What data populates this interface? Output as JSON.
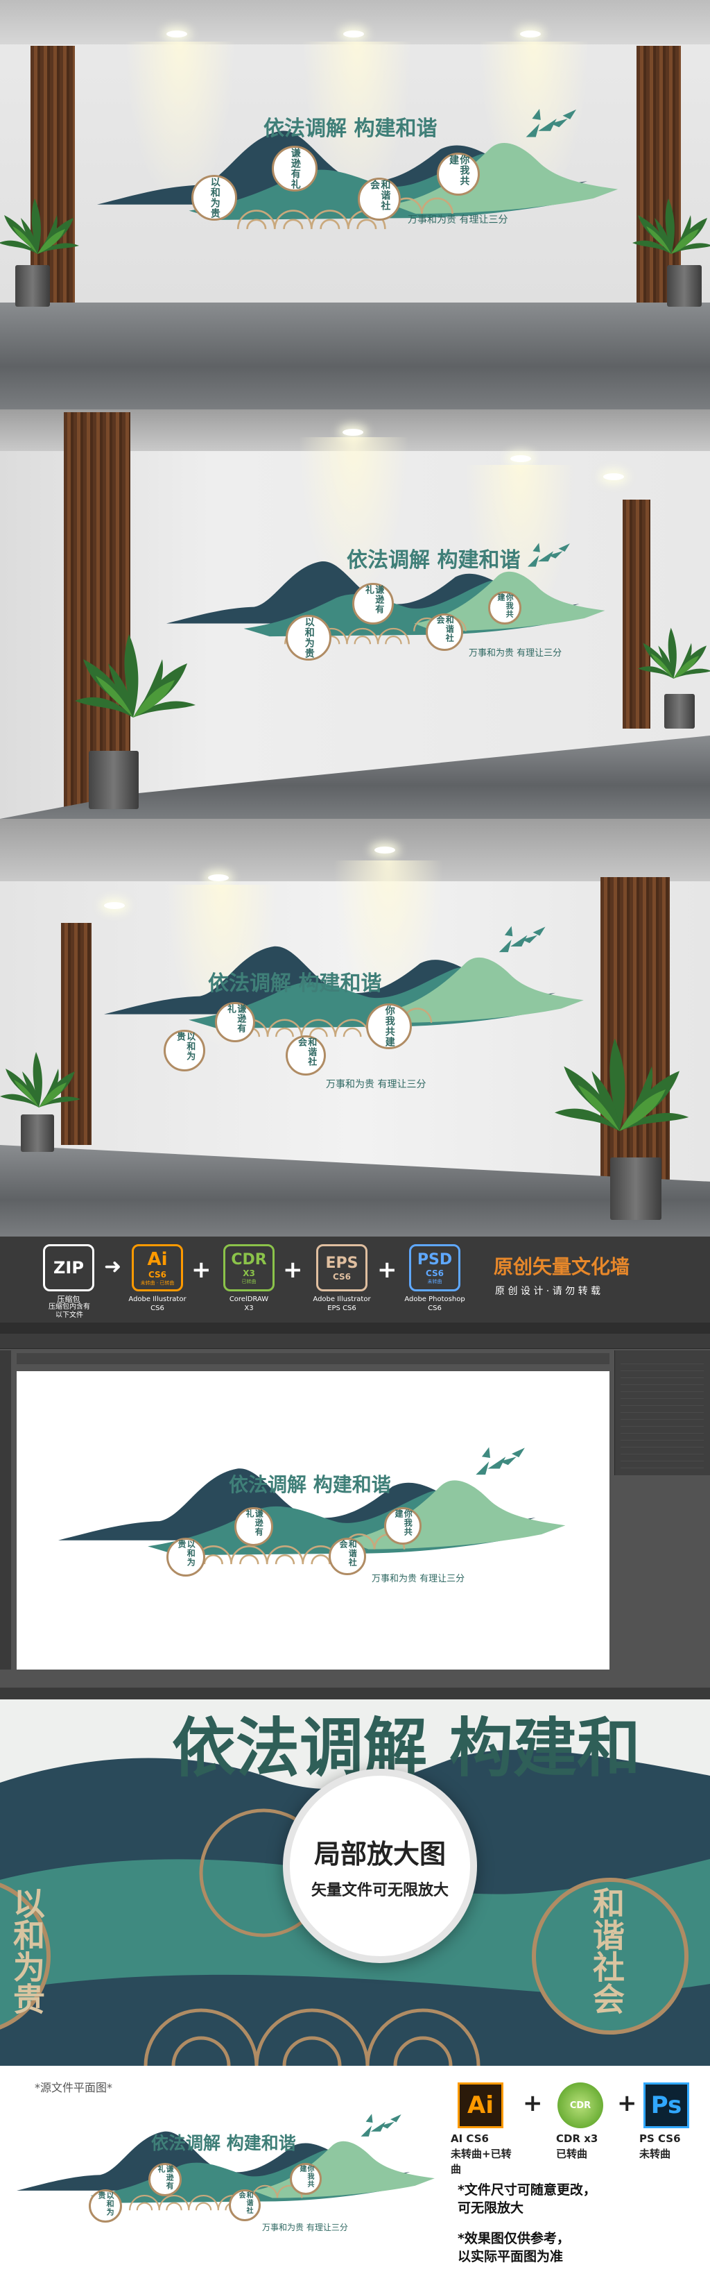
{
  "wall": {
    "title": "依法调解 构建和谐",
    "circles": [
      "以和为贵",
      "谦逊有礼",
      "和谐社会",
      "你我共建"
    ],
    "motto": "万事和为贵 有理让三分"
  },
  "toolbar": {
    "zip": {
      "label": "ZIP",
      "sub": "压缩包",
      "caption": "压缩包内含有\n以下文件"
    },
    "formats": [
      {
        "label": "Ai",
        "sub": "CS6",
        "note": "未转曲 · 已转曲",
        "caption": "Adobe Illustrator\nCS6",
        "color": "#ff9a00"
      },
      {
        "label": "CDR",
        "sub": "X3",
        "note": "已转曲",
        "caption": "CorelDRAW\nX3",
        "color": "#8bc34a"
      },
      {
        "label": "EPS",
        "sub": "CS6",
        "note": "",
        "caption": "Adobe Illustrator\nEPS CS6",
        "color": "#e0bfa0"
      },
      {
        "label": "PSD",
        "sub": "CS6",
        "note": "未转曲",
        "caption": "Adobe Photoshop\nCS6",
        "color": "#5fa8ff"
      }
    ],
    "headline": "原创矢量文化墙",
    "subline": "原 创 设 计 · 请 勿 转 载",
    "accent": "#e8882a"
  },
  "zoom": {
    "big_title": "依法调解 构建和",
    "left_vertical": "以和为贵",
    "right_vertical": "和谐社会",
    "badge_title": "局部放大图",
    "badge_sub": "矢量文件可无限放大"
  },
  "bottom": {
    "label": "*源文件平面图*",
    "formats": [
      {
        "label": "Ai",
        "caption": "AI CS6\n未转曲+已转曲"
      },
      {
        "label": "CDR",
        "caption": "CDR x3\n已转曲"
      },
      {
        "label": "Ps",
        "caption": "PS CS6\n未转曲"
      }
    ],
    "notes": [
      "*文件尺寸可随意更改，\n 可无限放大",
      "*效果图仅供参考，\n 以实际平面图为准"
    ]
  },
  "colors": {
    "dark_teal": "#2a4a5a",
    "teal": "#3f8a80",
    "light_green": "#8fc7a0",
    "gold": "#b08c64"
  }
}
